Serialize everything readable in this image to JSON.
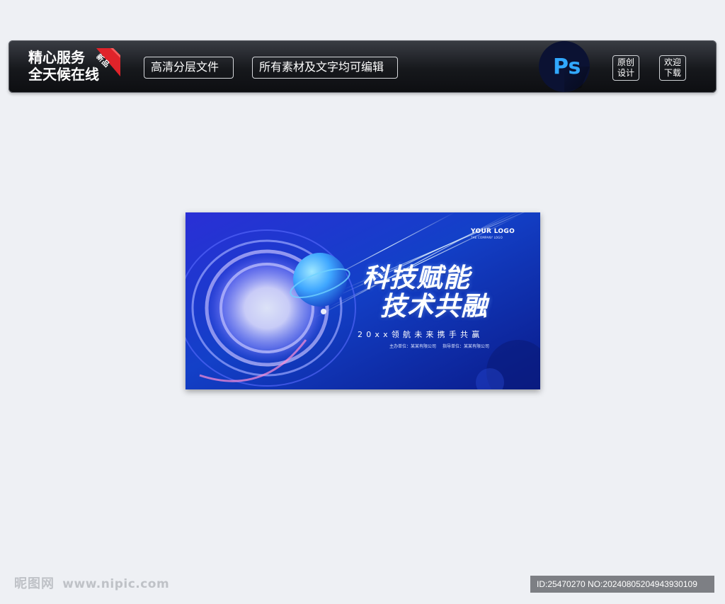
{
  "topbar": {
    "service_line1": "精心服务",
    "service_line2": "全天候在线",
    "ribbon": "新品",
    "pill_layers": "高清分层文件",
    "pill_editable": "所有素材及文字均可编辑",
    "ps_label": "Ps",
    "btn_original": [
      "原创",
      "设计"
    ],
    "btn_download": [
      "欢迎",
      "下载"
    ]
  },
  "poster": {
    "logo": "YOUR LOGO",
    "logo_sub": "THE COMPANY LOGO",
    "headline1": "科技赋能",
    "headline2": "技术共融",
    "subline": "20xx领航未来携手共赢",
    "organizer": "主办单位：某某有限公司",
    "guide": "指导单位：某某有限公司"
  },
  "footer": {
    "watermark_cn": "昵图网",
    "watermark_url": "www.nipic.com",
    "id_text": "ID:25470270 NO:20240805204943930109"
  },
  "colors": {
    "page_bg": "#eef0f4",
    "topbar_bg": "#16181c",
    "ribbon_red": "#e0232a",
    "ps_blue": "#31a8ff",
    "ps_bg": "#0b1233",
    "poster_blue": "#1436c8",
    "id_bar": "#7d7f84"
  }
}
